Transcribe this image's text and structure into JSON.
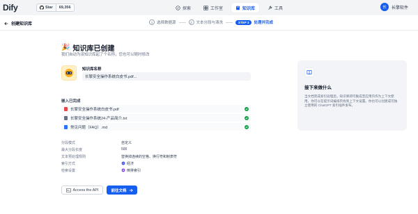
{
  "header": {
    "logo": "Dify",
    "github": {
      "star_label": "Star",
      "count": "69,356"
    },
    "nav": [
      {
        "label": "探索",
        "icon": "compass-icon",
        "active": false
      },
      {
        "label": "工作室",
        "icon": "grid-icon",
        "active": false
      },
      {
        "label": "知识库",
        "icon": "book-icon",
        "active": true
      },
      {
        "label": "工具",
        "icon": "tool-icon",
        "active": false
      }
    ],
    "user": {
      "avatar": "长",
      "name": "长擎软件"
    }
  },
  "stepbar": {
    "back_label": "创建知识库",
    "steps": [
      {
        "num": "1",
        "label": "选择数据源"
      },
      {
        "num": "2",
        "label": "文本分段与清洗"
      },
      {
        "badge": "STEP 3",
        "label": "处理并完成"
      }
    ]
  },
  "main": {
    "title": "知识库已创建",
    "subtitle": "我们自动为该知识库起了个名称，您也可以随时修改",
    "kb_label": "知识库名称",
    "kb_name": "长擎安全操作系统白皮书.pdf...",
    "embed_label": "嵌入已完成",
    "files": [
      {
        "name": "长擎安全操作系统白皮书.pdf",
        "type": "pdf",
        "color": "#e5484d"
      },
      {
        "name": "长擎安全操作系统24-产品简介.txt",
        "type": "txt",
        "color": "#667085"
      },
      {
        "name": "常见问题（FAQ）.md",
        "type": "md",
        "color": "#2970ff"
      }
    ],
    "props": [
      {
        "key": "分段模式",
        "value": "自定义"
      },
      {
        "key": "最大分段长度",
        "value": "500"
      },
      {
        "key": "文本预处理规则",
        "value": "替换掉连续的空格、换行符和制表符"
      },
      {
        "key": "索引方式",
        "value": "经济"
      },
      {
        "key": "检索设置",
        "value": "倒排索引"
      }
    ],
    "api_button": "Access the API",
    "doc_button": "前往文档"
  },
  "card": {
    "title": "接下来做什么",
    "body": "当文档完成索引处理后，知识库即可集成至应用内作为上下文使用，你可以在提示词编排页找到上下文设置。你也可以创建成可独立使用的 ChatGPT 索引插件发布。"
  },
  "colors": {
    "accent": "#155eef",
    "success": "#16a34a"
  }
}
